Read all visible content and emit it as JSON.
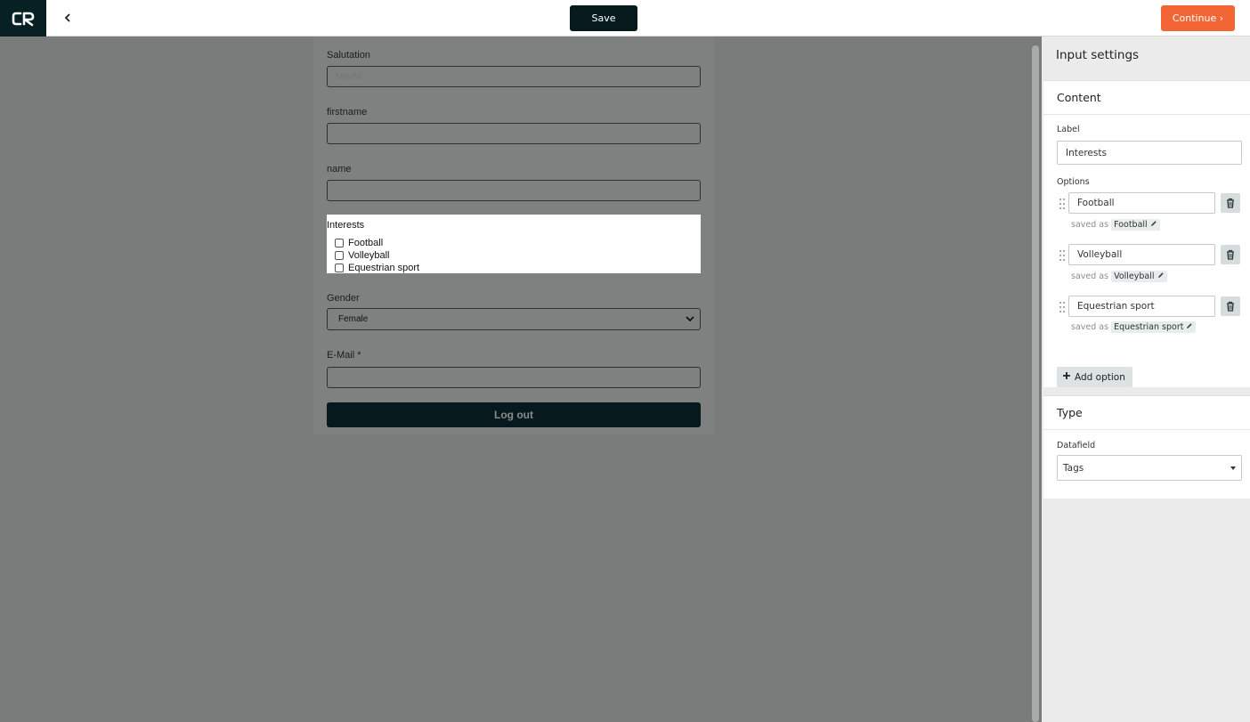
{
  "topbar": {
    "logo_icon": "cr-logo-icon",
    "back_icon": "chevron-left-icon",
    "save_label": "Save",
    "continue_label": "Continue ›",
    "colors": {
      "save_bg": "#06191c",
      "continue_bg": "#f26535",
      "logo_bg": "#062023"
    }
  },
  "form": {
    "salutation_label": "Salutation",
    "salutation_placeholder": "Mrs/Mr",
    "firstname_label": "firstname",
    "name_label": "name",
    "interests": {
      "title": "Interests",
      "options": [
        "Football",
        "Volleyball",
        "Equestrian sport"
      ]
    },
    "gender_label": "Gender",
    "gender_value": "Female",
    "email_label": "E-Mail *",
    "logout_label": "Log out"
  },
  "panel": {
    "title": "Input settings",
    "content": {
      "heading": "Content",
      "label_caption": "Label",
      "label_value": "Interests",
      "options_caption": "Options",
      "saved_as_text": "saved as",
      "options": [
        {
          "value": "Football",
          "saved_as": "Football"
        },
        {
          "value": "Volleyball",
          "saved_as": "Volleyball"
        },
        {
          "value": "Equestrian sport",
          "saved_as": "Equestrian sport"
        }
      ],
      "add_option_label": "Add option"
    },
    "type": {
      "heading": "Type",
      "datafield_caption": "Datafield",
      "datafield_value": "Tags"
    }
  }
}
